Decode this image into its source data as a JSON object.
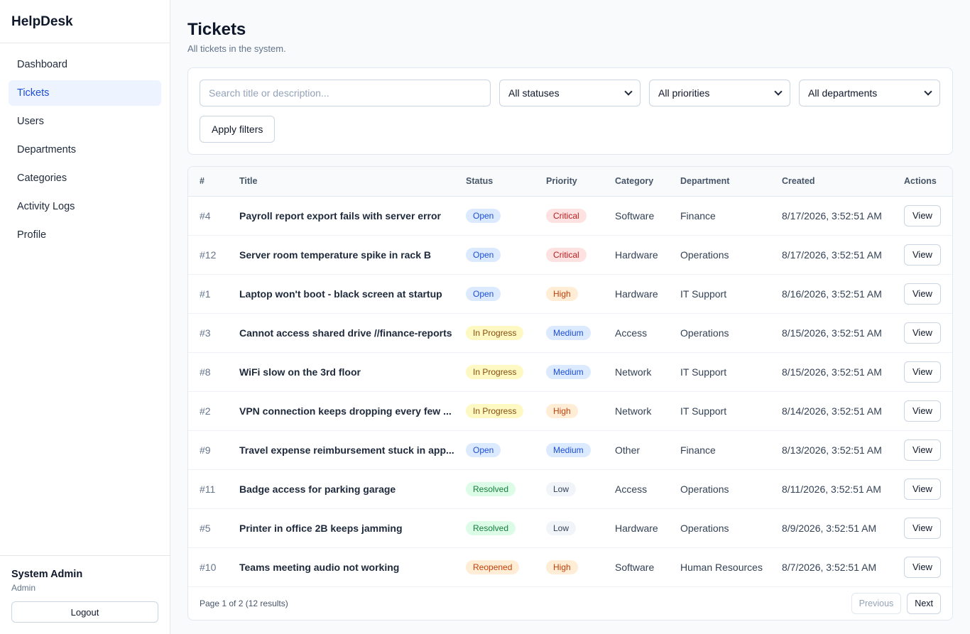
{
  "app": {
    "brand": "HelpDesk"
  },
  "sidebar": {
    "items": [
      {
        "label": "Dashboard",
        "active": false
      },
      {
        "label": "Tickets",
        "active": true
      },
      {
        "label": "Users",
        "active": false
      },
      {
        "label": "Departments",
        "active": false
      },
      {
        "label": "Categories",
        "active": false
      },
      {
        "label": "Activity Logs",
        "active": false
      },
      {
        "label": "Profile",
        "active": false
      }
    ],
    "user": {
      "name": "System Admin",
      "role": "Admin",
      "logout_label": "Logout"
    }
  },
  "page": {
    "title": "Tickets",
    "subtitle": "All tickets in the system."
  },
  "filters": {
    "search_placeholder": "Search title or description...",
    "search_value": "",
    "status": "All statuses",
    "priority": "All priorities",
    "department": "All departments",
    "apply_label": "Apply filters"
  },
  "table": {
    "columns": [
      "#",
      "Title",
      "Status",
      "Priority",
      "Category",
      "Department",
      "Created",
      "Actions"
    ],
    "rows": [
      {
        "num": "#4",
        "title": "Payroll report export fails with server error",
        "status": "Open",
        "priority": "Critical",
        "category": "Software",
        "department": "Finance",
        "created": "8/17/2026, 3:52:51 AM",
        "action": "View"
      },
      {
        "num": "#12",
        "title": "Server room temperature spike in rack B",
        "status": "Open",
        "priority": "Critical",
        "category": "Hardware",
        "department": "Operations",
        "created": "8/17/2026, 3:52:51 AM",
        "action": "View"
      },
      {
        "num": "#1",
        "title": "Laptop won't boot - black screen at startup",
        "status": "Open",
        "priority": "High",
        "category": "Hardware",
        "department": "IT Support",
        "created": "8/16/2026, 3:52:51 AM",
        "action": "View"
      },
      {
        "num": "#3",
        "title": "Cannot access shared drive //finance-reports",
        "status": "In Progress",
        "priority": "Medium",
        "category": "Access",
        "department": "Operations",
        "created": "8/15/2026, 3:52:51 AM",
        "action": "View"
      },
      {
        "num": "#8",
        "title": "WiFi slow on the 3rd floor",
        "status": "In Progress",
        "priority": "Medium",
        "category": "Network",
        "department": "IT Support",
        "created": "8/15/2026, 3:52:51 AM",
        "action": "View"
      },
      {
        "num": "#2",
        "title": "VPN connection keeps dropping every few ...",
        "status": "In Progress",
        "priority": "High",
        "category": "Network",
        "department": "IT Support",
        "created": "8/14/2026, 3:52:51 AM",
        "action": "View"
      },
      {
        "num": "#9",
        "title": "Travel expense reimbursement stuck in app...",
        "status": "Open",
        "priority": "Medium",
        "category": "Other",
        "department": "Finance",
        "created": "8/13/2026, 3:52:51 AM",
        "action": "View"
      },
      {
        "num": "#11",
        "title": "Badge access for parking garage",
        "status": "Resolved",
        "priority": "Low",
        "category": "Access",
        "department": "Operations",
        "created": "8/11/2026, 3:52:51 AM",
        "action": "View"
      },
      {
        "num": "#5",
        "title": "Printer in office 2B keeps jamming",
        "status": "Resolved",
        "priority": "Low",
        "category": "Hardware",
        "department": "Operations",
        "created": "8/9/2026, 3:52:51 AM",
        "action": "View"
      },
      {
        "num": "#10",
        "title": "Teams meeting audio not working",
        "status": "Reopened",
        "priority": "High",
        "category": "Software",
        "department": "Human Resources",
        "created": "8/7/2026, 3:52:51 AM",
        "action": "View"
      }
    ]
  },
  "pagination": {
    "info": "Page 1 of 2 (12 results)",
    "prev_label": "Previous",
    "next_label": "Next",
    "prev_disabled": true
  },
  "colors": {
    "accent": "#1d4ed8",
    "status": {
      "Open": {
        "bg": "#dbeafe",
        "fg": "#1d4ed8"
      },
      "In Progress": {
        "bg": "#fef9c3",
        "fg": "#854d0e"
      },
      "Resolved": {
        "bg": "#dcfce7",
        "fg": "#15803d"
      },
      "Reopened": {
        "bg": "#ffedd5",
        "fg": "#c2410c"
      }
    },
    "priority": {
      "Critical": {
        "bg": "#fee2e2",
        "fg": "#b91c1c"
      },
      "High": {
        "bg": "#ffedd5",
        "fg": "#c2410c"
      },
      "Medium": {
        "bg": "#dbeafe",
        "fg": "#1d4ed8"
      },
      "Low": {
        "bg": "#f1f5f9",
        "fg": "#334155"
      }
    }
  }
}
